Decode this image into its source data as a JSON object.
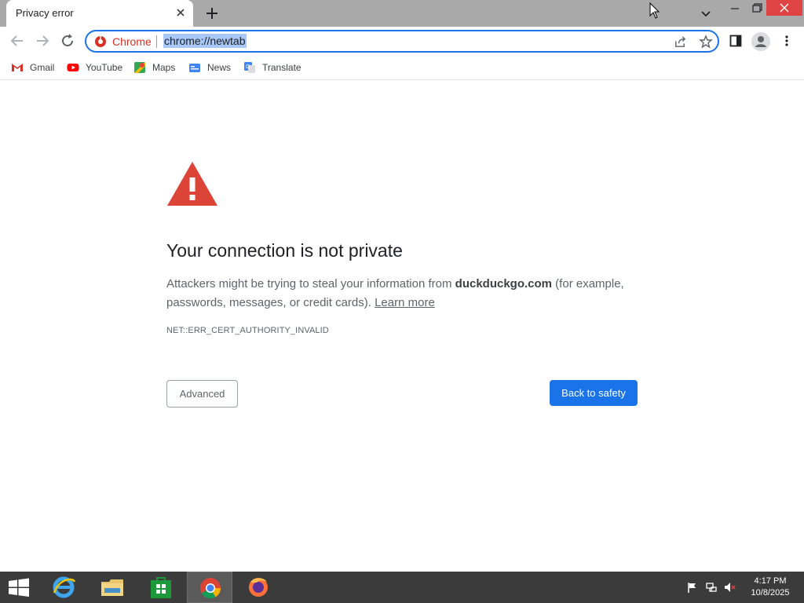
{
  "tab": {
    "title": "Privacy error"
  },
  "omnibox": {
    "site_label": "Chrome",
    "url": "chrome://newtab"
  },
  "bookmarks": [
    {
      "label": "Gmail",
      "icon": "gmail-icon"
    },
    {
      "label": "YouTube",
      "icon": "youtube-icon"
    },
    {
      "label": "Maps",
      "icon": "maps-icon"
    },
    {
      "label": "News",
      "icon": "news-icon"
    },
    {
      "label": "Translate",
      "icon": "translate-icon"
    }
  ],
  "interstitial": {
    "headline": "Your connection is not private",
    "text_before": "Attackers might be trying to steal your information from ",
    "domain": "duckduckgo.com",
    "text_after": " (for example, passwords, messages, or credit cards). ",
    "learn_more": "Learn more",
    "error_code": "NET::ERR_CERT_AUTHORITY_INVALID",
    "advanced_label": "Advanced",
    "back_label": "Back to safety"
  },
  "taskbar": {
    "apps": [
      "internet-explorer",
      "file-explorer",
      "store",
      "chrome",
      "firefox"
    ],
    "active_app": "chrome",
    "time": "4:17 PM",
    "date": "10/8/2025"
  },
  "colors": {
    "accent": "#1a73e8",
    "warning": "#db4437",
    "close": "#e04343"
  }
}
